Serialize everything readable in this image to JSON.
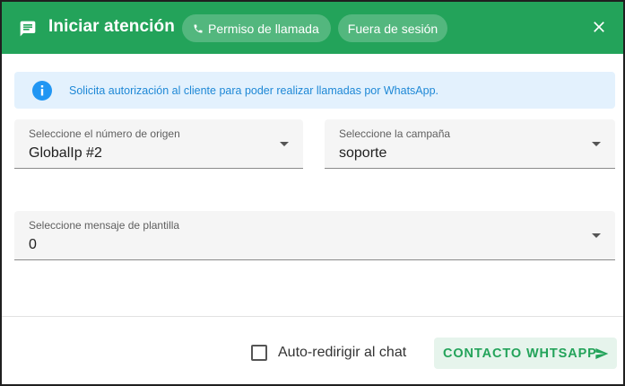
{
  "header": {
    "title": "Iniciar atención",
    "chips": {
      "call_permission": "Permiso de llamada",
      "session": "Fuera de sesión"
    },
    "icons": {
      "chat": "chat-bubble-icon",
      "phone": "phone-icon",
      "close": "close-icon"
    },
    "background_color": "#23a35a"
  },
  "banner": {
    "text": "Solicita autorización al cliente para poder realizar llamadas por WhatsApp.",
    "icon": "info-icon",
    "text_color": "#1e88d6",
    "background_color": "#e3f1fd"
  },
  "form": {
    "origin_number": {
      "label": "Seleccione el número de origen",
      "value": "GlobalIp #2"
    },
    "campaign": {
      "label": "Seleccione la campaña",
      "value": "soporte"
    },
    "template": {
      "label": "Seleccione mensaje de plantilla",
      "value": "0"
    }
  },
  "footer": {
    "auto_redirect": {
      "label": "Auto-redirigir al chat",
      "checked": false
    },
    "contact_button": {
      "label": "CONTACTO WHTSAPP",
      "icon": "send-icon"
    }
  }
}
